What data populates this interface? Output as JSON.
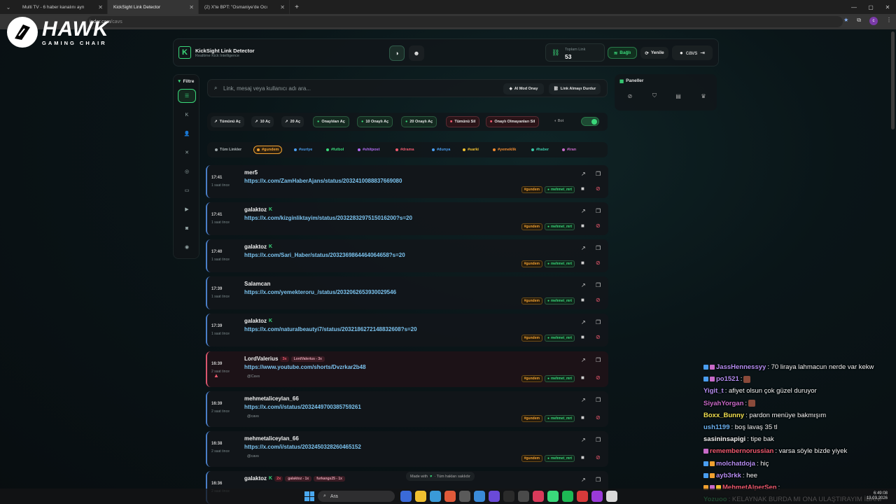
{
  "browser": {
    "tabs": [
      {
        "title": "Multi TV - 6 haber kanalını ayn",
        "active": false
      },
      {
        "title": "KickSight Link Detector",
        "active": true
      },
      {
        "title": "(2) X'te BPT: \"Osmaniye'de Ocı",
        "active": false
      }
    ],
    "address_host": "inder.com",
    "address_path": "/cavs"
  },
  "overlay_logo": {
    "title": "HAWK",
    "subtitle": "GAMING CHAIR"
  },
  "header": {
    "app_title": "KickSight Link Detector",
    "app_subtitle": "Realtime Kick Intelligence",
    "total_label": "Toplam Link",
    "total_value": "53",
    "connected_label": "Bağlı",
    "refresh_label": "Yenile",
    "username": "cavs"
  },
  "filter": {
    "label": "Filtre",
    "items": [
      "list",
      "kick",
      "users",
      "x",
      "instagram",
      "youtube",
      "video",
      "camera",
      "globe"
    ]
  },
  "search": {
    "placeholder": "Link, mesaj veya kullanıcı adı ara...",
    "ai_mode_label": "AI Mod Onay",
    "stop_label": "Link Almayı Durdur"
  },
  "actions": {
    "open_all": "Tümünü Aç",
    "open_10": "10 Aç",
    "open_20": "20 Aç",
    "open_approved": "Onaylıları Aç",
    "open_10_approved": "10 Onaylı Aç",
    "open_20_approved": "20 Onaylı Aç",
    "delete_all": "Tümünü Sil",
    "delete_unapproved": "Onaylı Olmayanları Sil",
    "bot_label": "Bot",
    "bot_enabled": true
  },
  "tags": [
    {
      "label": "Tüm Linkler",
      "color": "#9aa4a6",
      "selected": false
    },
    {
      "label": "#gundem",
      "color": "#f0a030",
      "selected": true
    },
    {
      "label": "#suriye",
      "color": "#4a9ef0",
      "selected": false
    },
    {
      "label": "#futbol",
      "color": "#3ad87a",
      "selected": false
    },
    {
      "label": "#shitpost",
      "color": "#b06af0",
      "selected": false
    },
    {
      "label": "#drama",
      "color": "#ef5a6f",
      "selected": false
    },
    {
      "label": "#dunya",
      "color": "#4a9ef0",
      "selected": false
    },
    {
      "label": "#sarki",
      "color": "#f0c030",
      "selected": false
    },
    {
      "label": "#yemeklik",
      "color": "#f08a30",
      "selected": false
    },
    {
      "label": "#haber",
      "color": "#3ac8a8",
      "selected": false
    },
    {
      "label": "#iran",
      "color": "#c86ac8",
      "selected": false
    }
  ],
  "links": [
    {
      "time": "17:41",
      "ago": "1 saat önce",
      "user": "mer5",
      "kick": false,
      "url": "https://x.com/ZamHaberAjans/status/2032410088837669080",
      "by": "",
      "tags": [
        "#gundem",
        "mehmet_mrt"
      ]
    },
    {
      "time": "17:41",
      "ago": "1 saat önce",
      "user": "galaktoz",
      "kick": true,
      "url": "https://x.com/kizginliktayim/status/2032283297515016200?s=20",
      "by": "",
      "tags": [
        "#gundem",
        "mehmet_mrt"
      ]
    },
    {
      "time": "17:40",
      "ago": "1 saat önce",
      "user": "galaktoz",
      "kick": true,
      "url": "https://x.com/Sari_Haber/status/2032369864464064658?s=20",
      "by": "",
      "tags": [
        "#gundem",
        "mehmet_mrt"
      ]
    },
    {
      "time": "17:39",
      "ago": "1 saat önce",
      "user": "Salamcan",
      "kick": false,
      "url": "https://x.com/yemekteroru_/status/2032062653930029546",
      "by": "",
      "tags": [
        "#gundem",
        "mehmet_mrt"
      ]
    },
    {
      "time": "17:39",
      "ago": "1 saat önce",
      "user": "galaktoz",
      "kick": true,
      "url": "https://x.com/naturalbeautyi7/status/2032186272148832608?s=20",
      "by": "",
      "tags": [
        "#gundem",
        "mehmet_mrt"
      ]
    },
    {
      "time": "16:39",
      "ago": "2 saat önce",
      "user": "LordValerius",
      "kick": false,
      "count": "3x",
      "counter": "LordValerius - 3x",
      "url": "https://www.youtube.com/shorts/Dvzrkar2b48",
      "by": "@Cavs",
      "tags": [
        "#gundem",
        "mehmet_mrt"
      ],
      "warn": true
    },
    {
      "time": "16:39",
      "ago": "2 saat önce",
      "user": "mehmetaliceylan_66",
      "kick": false,
      "url": "https://x.com/i/status/2032449700385759261",
      "by": "@cavs",
      "tags": [
        "#gundem",
        "mehmet_mrt"
      ]
    },
    {
      "time": "16:38",
      "ago": "2 saat önce",
      "user": "mehmetaliceylan_66",
      "kick": false,
      "url": "https://x.com/i/status/2032450328260465152",
      "by": "@cavs",
      "tags": [
        "#gundem",
        "mehmet_mrt"
      ]
    },
    {
      "time": "16:36",
      "ago": "2 saat önce",
      "user": "galaktoz",
      "kick": true,
      "count": "2x",
      "counter": "galaktoz - 1x",
      "counter2": "furkangs25 - 1x",
      "url": "",
      "by": "",
      "tags": []
    }
  ],
  "panels": {
    "label": "Paneller",
    "items": [
      "ban",
      "shield",
      "archive",
      "trophy"
    ]
  },
  "chat": [
    {
      "name": "JassHennessyy",
      "color": "#b48cf0",
      "msg": ": 70 liraya lahmacun nerde var kekw",
      "badges": [
        "#4a9ef0",
        "#c86ac8"
      ]
    },
    {
      "name": "po1521",
      "color": "#b48cf0",
      "msg": ":",
      "badges": [
        "#4a9ef0",
        "#c86ac8"
      ],
      "emote": true
    },
    {
      "name": "Yigit_t",
      "color": "#b48cf0",
      "msg": ": afiyet olsun çok güzel duruyor",
      "badges": []
    },
    {
      "name": "SiyahYorgan",
      "color": "#c86ac8",
      "msg": ":",
      "badges": [],
      "emote": true
    },
    {
      "name": "Boxx_Bunny",
      "color": "#f0e050",
      "msg": ": pardon menüye bakmışım",
      "badges": []
    },
    {
      "name": "ush1199",
      "color": "#6ab0f0",
      "msg": ": boş lavaş 35 tl",
      "badges": []
    },
    {
      "name": "sasininsapigi",
      "color": "#f0f0f0",
      "msg": ": tipe bak",
      "badges": []
    },
    {
      "name": "remembernorussian",
      "color": "#ef5a6f",
      "msg": ": varsa söyle bizde yiyek",
      "badges": [
        "#c86ac8"
      ]
    },
    {
      "name": "molchatdoja",
      "color": "#b48cf0",
      "msg": ": hiç",
      "badges": [
        "#4a9ef0",
        "#f0a030"
      ]
    },
    {
      "name": "ayb3rkk",
      "color": "#b48cf0",
      "msg": ": hee",
      "badges": [
        "#4a9ef0",
        "#f0a030"
      ]
    },
    {
      "name": "MehmetAlperSen",
      "color": "#ef5a6f",
      "msg": ":",
      "badges": [
        "#f0a030",
        "#c86ac8",
        "#f0c030"
      ]
    },
    {
      "name": "Yozuoo",
      "color": "#3ad87a",
      "msg": ": KELAYNAK BURDA MI ONA ULAŞTIRAYIM İBANI",
      "badges": []
    }
  ],
  "footer": {
    "made_with": "Made with",
    "rights": "· Tüm hakları saklıdır"
  },
  "taskbar": {
    "search": "Ara",
    "time": "6:49:08",
    "date": "13.03.2026"
  }
}
